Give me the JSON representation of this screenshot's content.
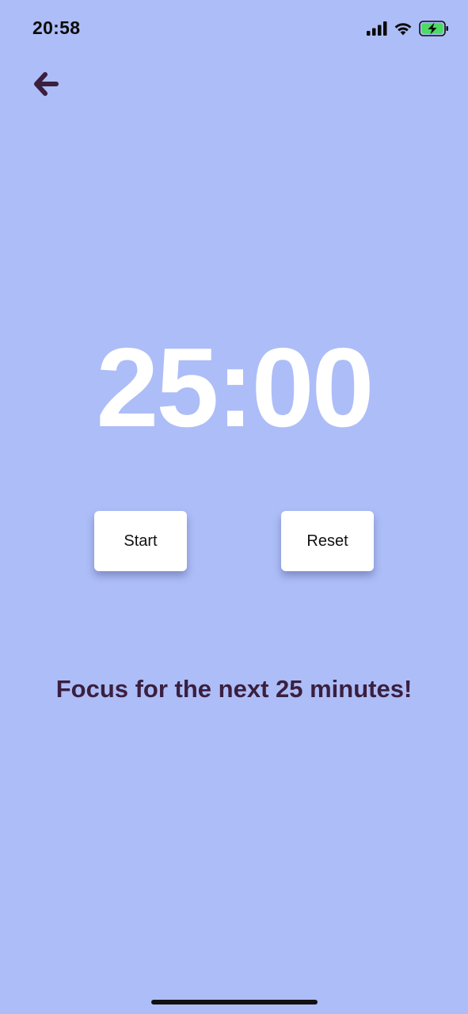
{
  "status_bar": {
    "time": "20:58",
    "icons": [
      "cellular-signal-icon",
      "wifi-icon",
      "battery-charging-icon"
    ],
    "battery_color": "#4cd964"
  },
  "nav": {
    "back_icon": "arrow-left-icon",
    "icon_color": "#3a1f3f"
  },
  "timer": {
    "display": "25:00"
  },
  "controls": {
    "start_label": "Start",
    "reset_label": "Reset"
  },
  "message": {
    "text": "Focus for the next 25 minutes!"
  },
  "theme": {
    "background": "#adbdf7",
    "accent_text": "#3a1f3f",
    "timer_color": "#ffffff"
  }
}
